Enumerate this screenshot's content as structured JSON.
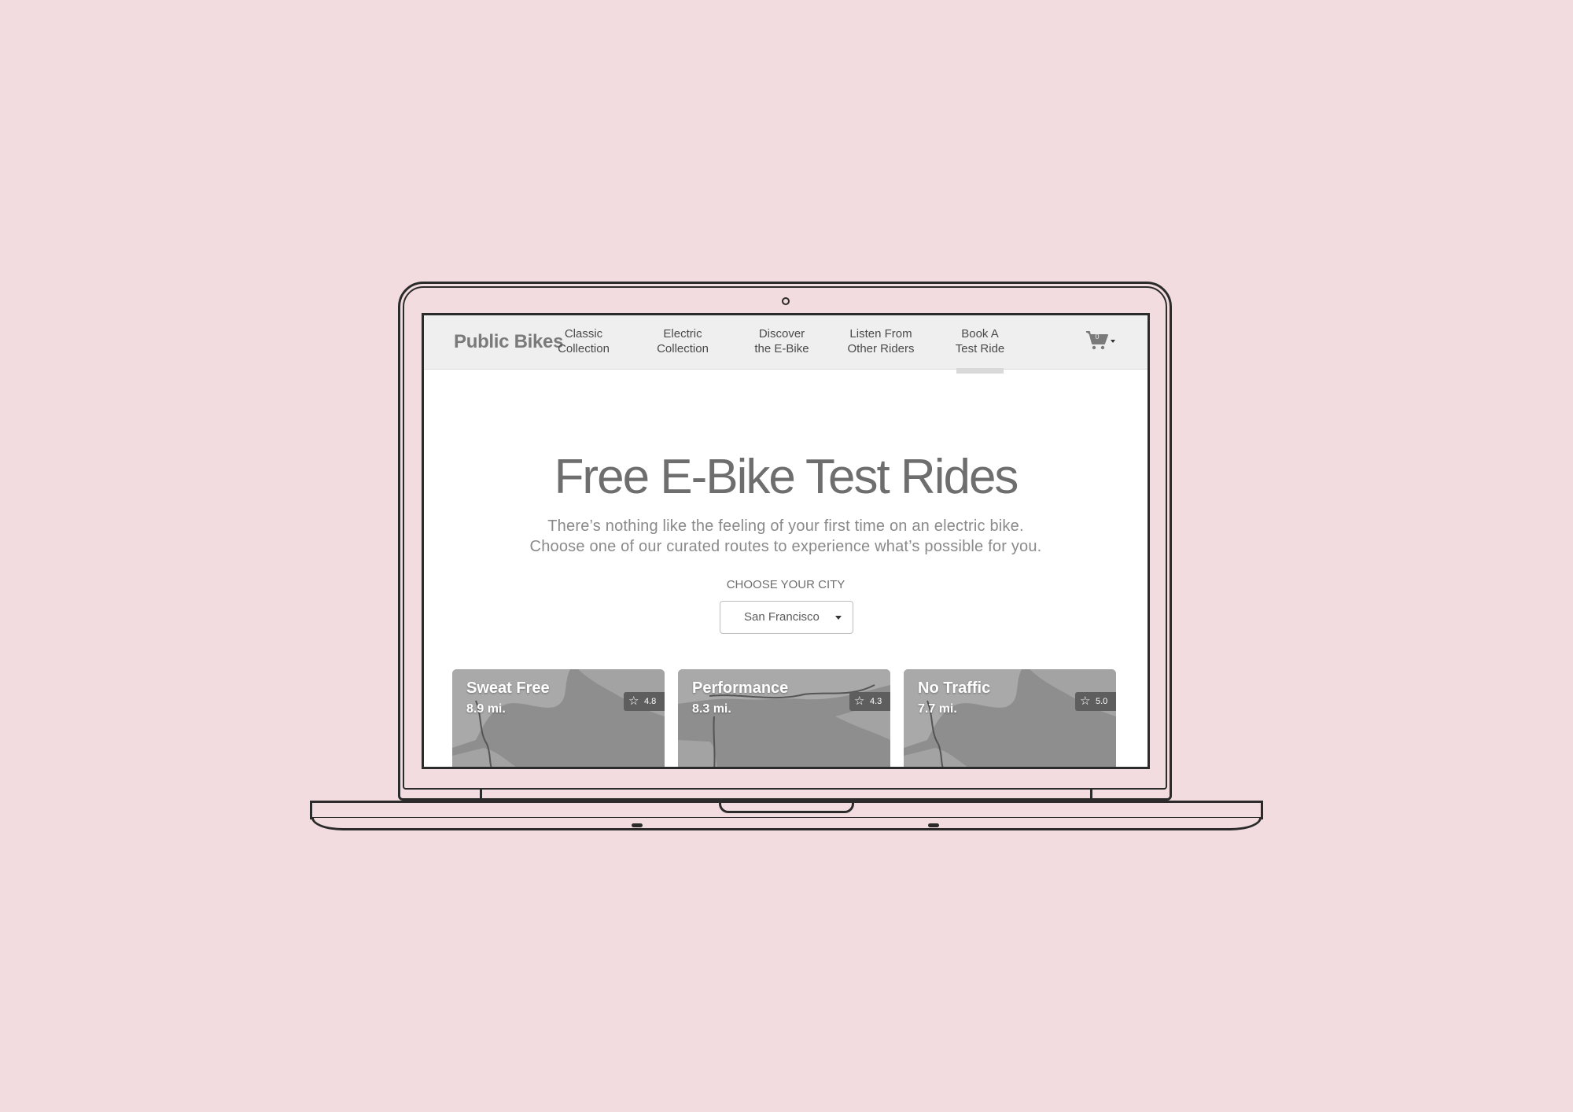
{
  "nav": {
    "brand": "Public Bikes",
    "items": [
      {
        "label": "Classic\nCollection"
      },
      {
        "label": "Electric\nCollection"
      },
      {
        "label": "Discover\nthe E-Bike"
      },
      {
        "label": "Listen From\nOther Riders"
      },
      {
        "label": "Book A\nTest Ride",
        "active": true
      }
    ],
    "cart_count": "0",
    "cart_icon": "cart-icon"
  },
  "hero": {
    "title": "Free E-Bike Test Rides",
    "subtitle_line1": "There’s nothing like the feeling of your first time on an electric bike.",
    "subtitle_line2": "Choose one of our curated routes to experience what’s possible for you."
  },
  "city": {
    "label": "CHOOSE YOUR CITY",
    "selected": "San Francisco"
  },
  "routes": [
    {
      "title": "Sweat Free",
      "distance": "8.9 mi.",
      "rating": "4.8"
    },
    {
      "title": "Performance",
      "distance": "8.3 mi.",
      "rating": "4.3"
    },
    {
      "title": "No Traffic",
      "distance": "7.7 mi.",
      "rating": "5.0"
    }
  ],
  "colors": {
    "background": "#f2dcdf",
    "navbar": "#efefef",
    "map_water": "#8e8e8e",
    "map_land": "#a9a9a9"
  }
}
